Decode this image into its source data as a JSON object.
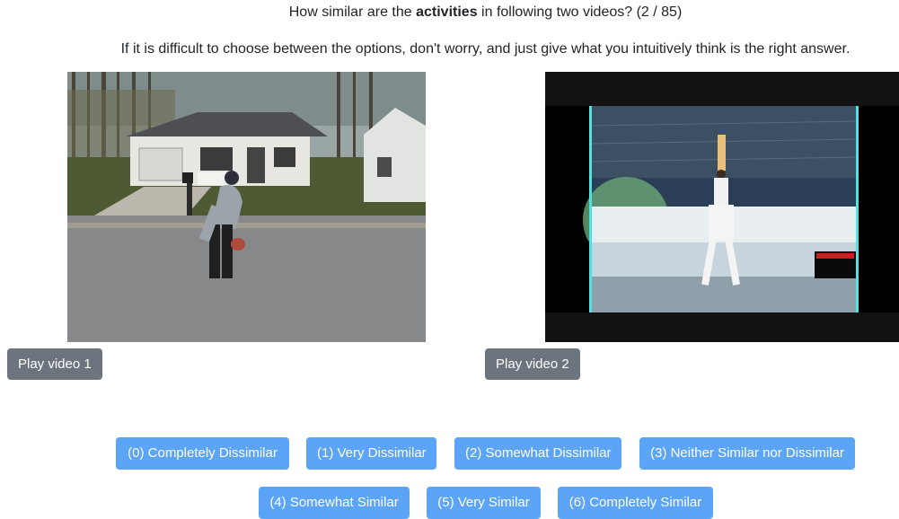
{
  "question": {
    "prefix": "How similar are the ",
    "emphasis": "activities",
    "suffix": " in following two videos? (2 / 85)"
  },
  "hint": "If it is difficult to choose between the options, don't worry, and just give what you intuitively think is the right answer.",
  "videos": [
    {
      "play_label": "Play video 1"
    },
    {
      "play_label": "Play video 2"
    }
  ],
  "options": [
    "(0) Completely Dissimilar",
    "(1) Very Dissimilar",
    "(2) Somewhat Dissimilar",
    "(3) Neither Similar nor Dissimilar",
    "(4) Somewhat Similar",
    "(5) Very Similar",
    "(6) Completely Similar"
  ],
  "colors": {
    "primary": "#5ba4f6",
    "secondary": "#6c757d"
  }
}
